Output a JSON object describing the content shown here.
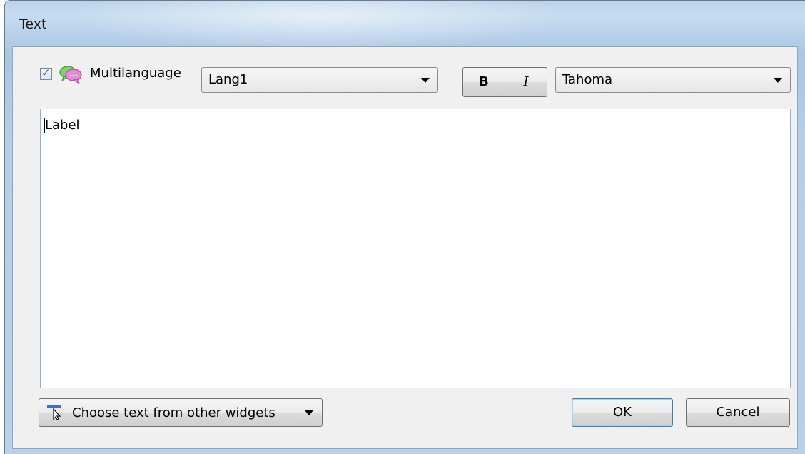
{
  "window": {
    "title": "Text"
  },
  "toolbar": {
    "multilanguage_checked": true,
    "multilanguage_label": "Multilanguage",
    "multilanguage_icon": "speech-bubbles-icon",
    "language_value": "Lang1",
    "bold_label": "B",
    "italic_label": "I",
    "font_value": "Tahoma"
  },
  "editor": {
    "text": "Label"
  },
  "footer": {
    "choose_label": "Choose text from other widgets",
    "choose_icon": "pointer-select-icon",
    "ok_label": "OK",
    "cancel_label": "Cancel"
  },
  "colors": {
    "title_bar": "#b9d2ea",
    "client": "#f0f0f0",
    "default_button_border": "#3c7fb1",
    "checkbox_mark": "#2a4f9e"
  }
}
